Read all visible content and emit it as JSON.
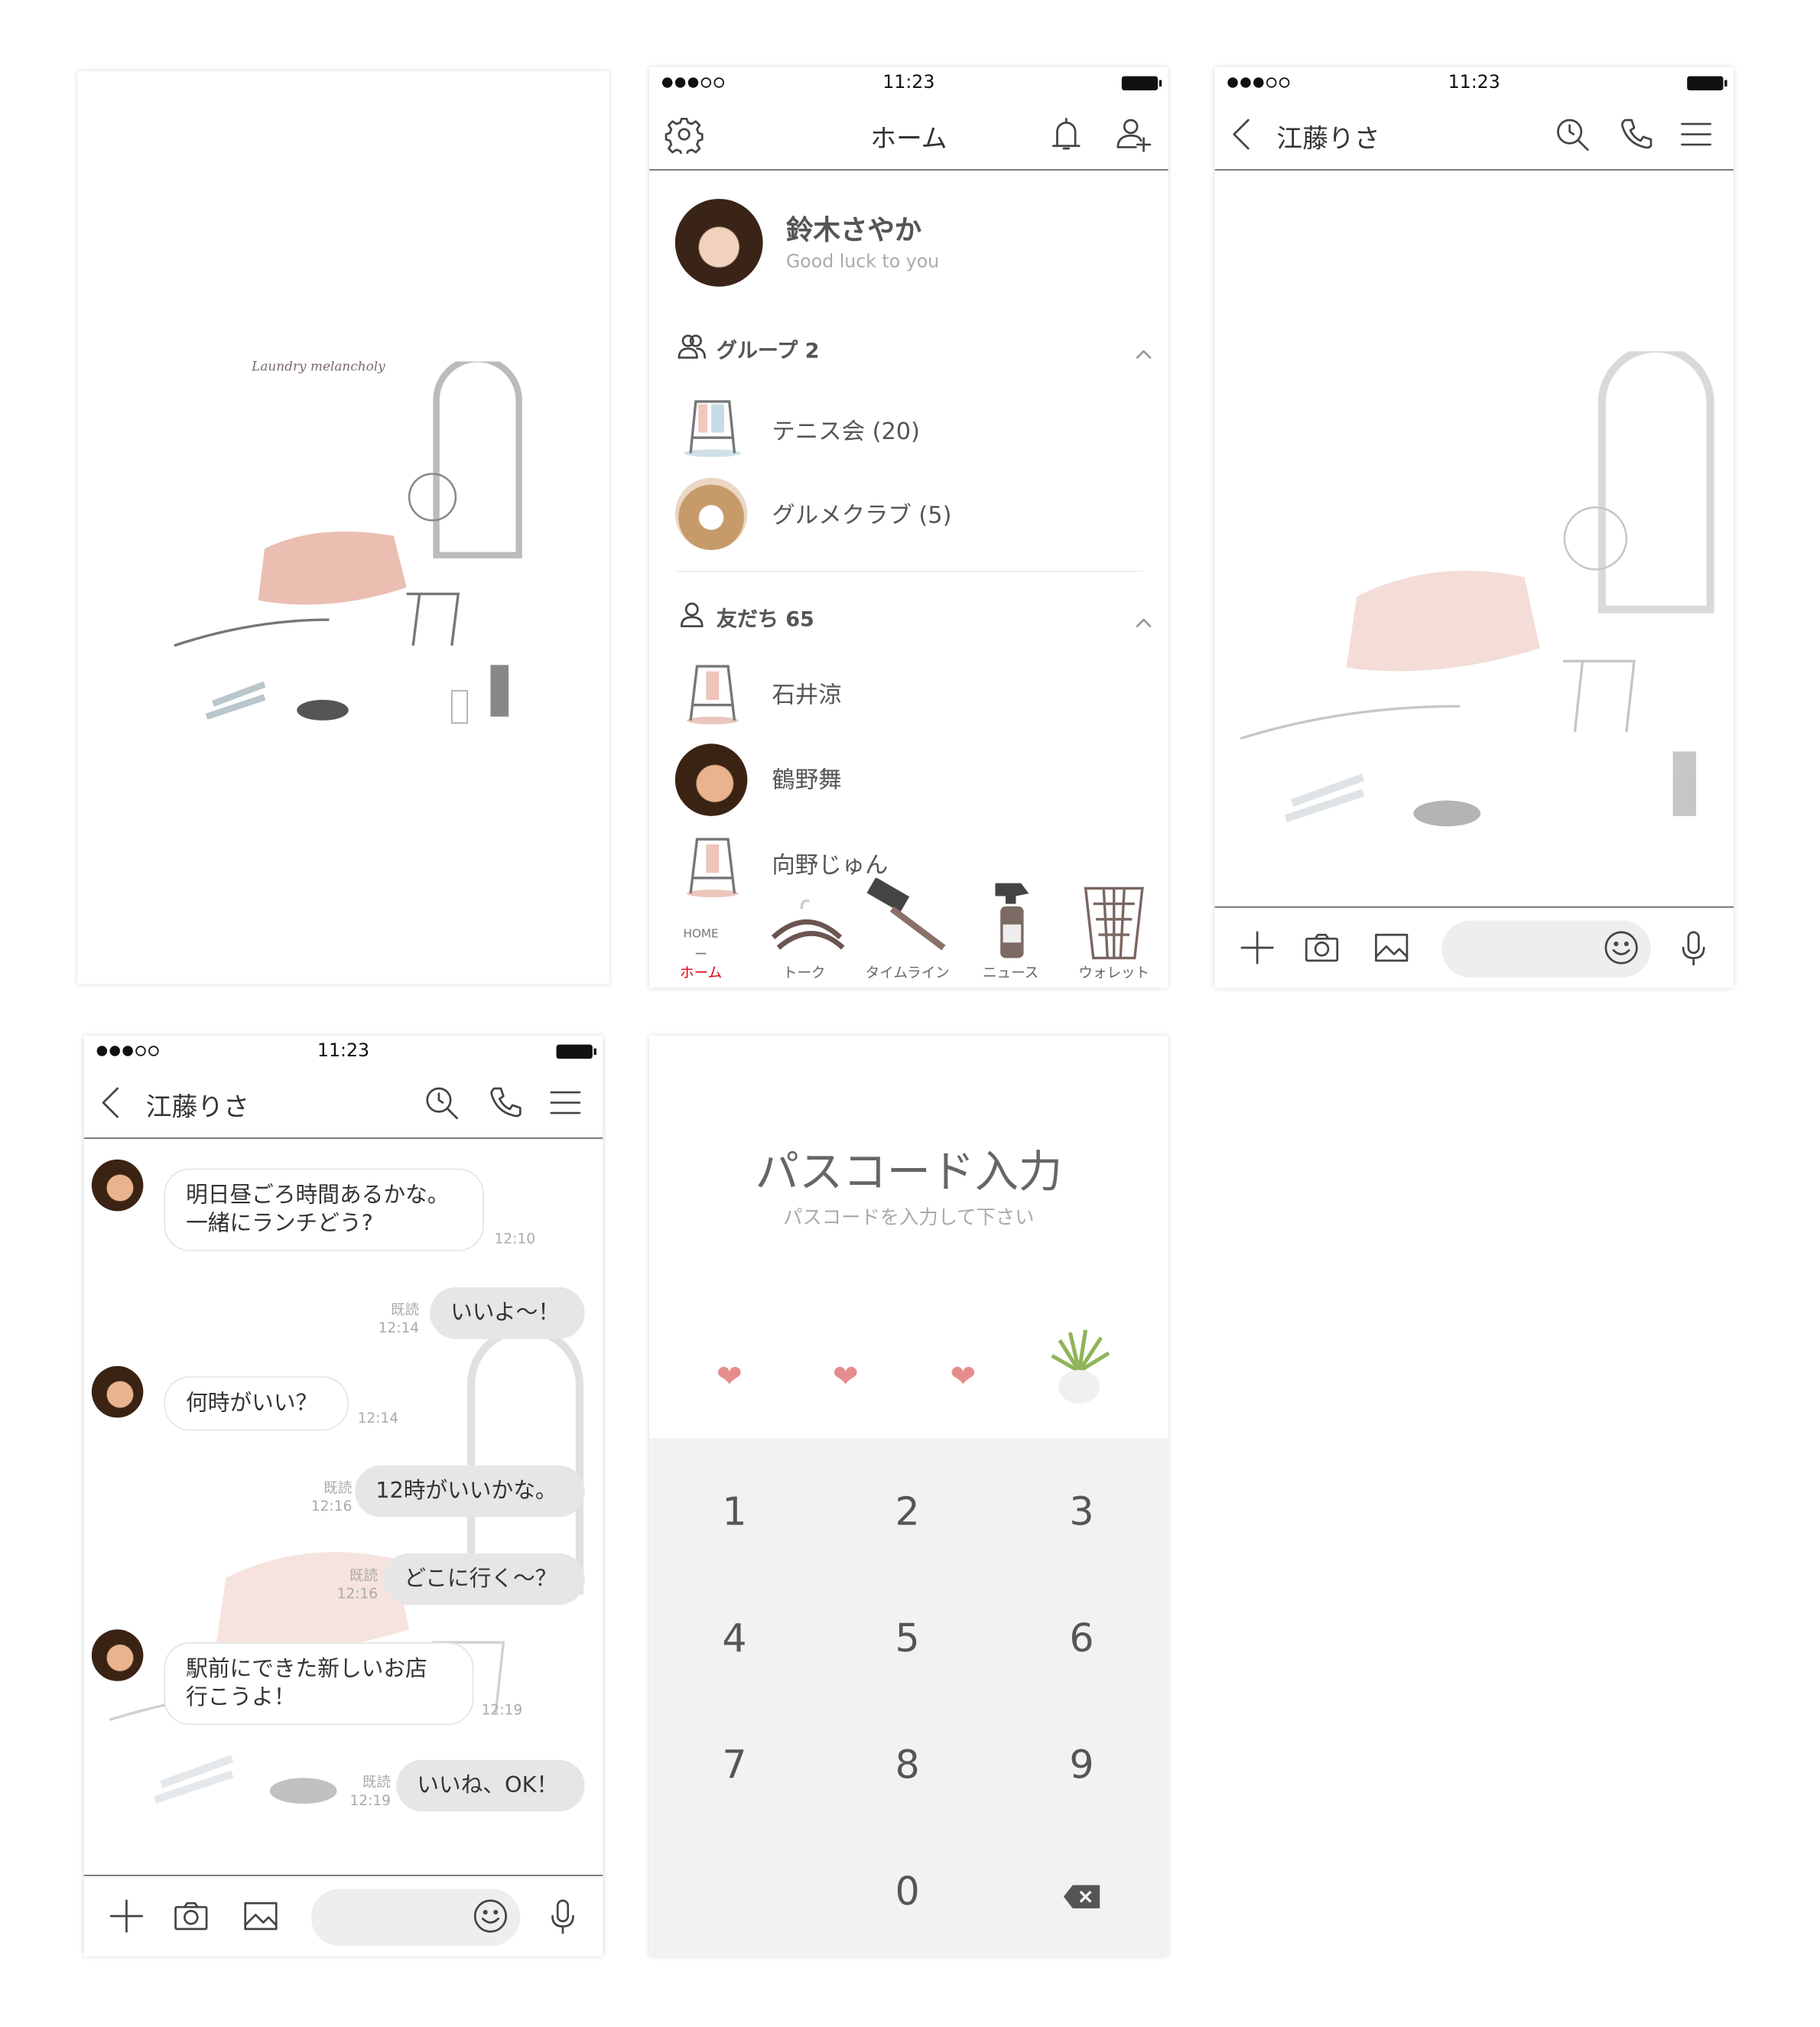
{
  "theme": {
    "accent": "#e60012",
    "keypad_bg": "#f2f2f2",
    "heart": "#e58d8d",
    "sent_bubble": "#e6e6e6"
  },
  "cover": {
    "caption": "Laundry melancholy"
  },
  "status": {
    "time": "11:23",
    "signal_bars": 3,
    "signal_total": 5,
    "battery": 100
  },
  "home": {
    "title": "ホーム",
    "icons": [
      "gear-icon",
      "bell-icon",
      "add-friend-icon"
    ],
    "profile": {
      "name": "鈴木さやか",
      "status": "Good luck to you"
    },
    "groups": {
      "label": "グループ 2",
      "items": [
        {
          "name": "テニス会 (20)"
        },
        {
          "name": "グルメクラブ (5)"
        }
      ]
    },
    "friends": {
      "label": "友だち 65",
      "items": [
        {
          "name": "石井涼"
        },
        {
          "name": "鶴野舞"
        },
        {
          "name": "向野じゅん"
        }
      ]
    },
    "tabs": [
      {
        "label": "ホーム",
        "sublabel": "HOME",
        "active": true
      },
      {
        "label": "トーク"
      },
      {
        "label": "タイムライン"
      },
      {
        "label": "ニュース"
      },
      {
        "label": "ウォレット"
      }
    ]
  },
  "chat_empty": {
    "title": "江藤りさ"
  },
  "chat": {
    "title": "江藤りさ",
    "messages": [
      {
        "dir": "in",
        "text": "明日昼ごろ時間あるかな。\n一緒にランチどう?",
        "time": "12:10"
      },
      {
        "dir": "out",
        "text": "いいよ～！",
        "read": "既読",
        "time": "12:14"
      },
      {
        "dir": "in",
        "text": "何時がいい？",
        "time": "12:14"
      },
      {
        "dir": "out",
        "text": "12時がいいかな。",
        "read": "既読",
        "time": "12:16"
      },
      {
        "dir": "out",
        "text": "どこに行く～？",
        "read": "既読",
        "time": "12:16"
      },
      {
        "dir": "in",
        "text": "駅前にできた新しいお店\n行こうよ！",
        "time": "12:19"
      },
      {
        "dir": "out",
        "text": "いいね、OK！",
        "read": "既読",
        "time": "12:19"
      }
    ]
  },
  "passcode": {
    "title": "パスコード入力",
    "subtitle": "パスコードを入力して下さい",
    "entered": 3,
    "length": 4,
    "keys": [
      "1",
      "2",
      "3",
      "4",
      "5",
      "6",
      "7",
      "8",
      "9",
      "0"
    ]
  }
}
